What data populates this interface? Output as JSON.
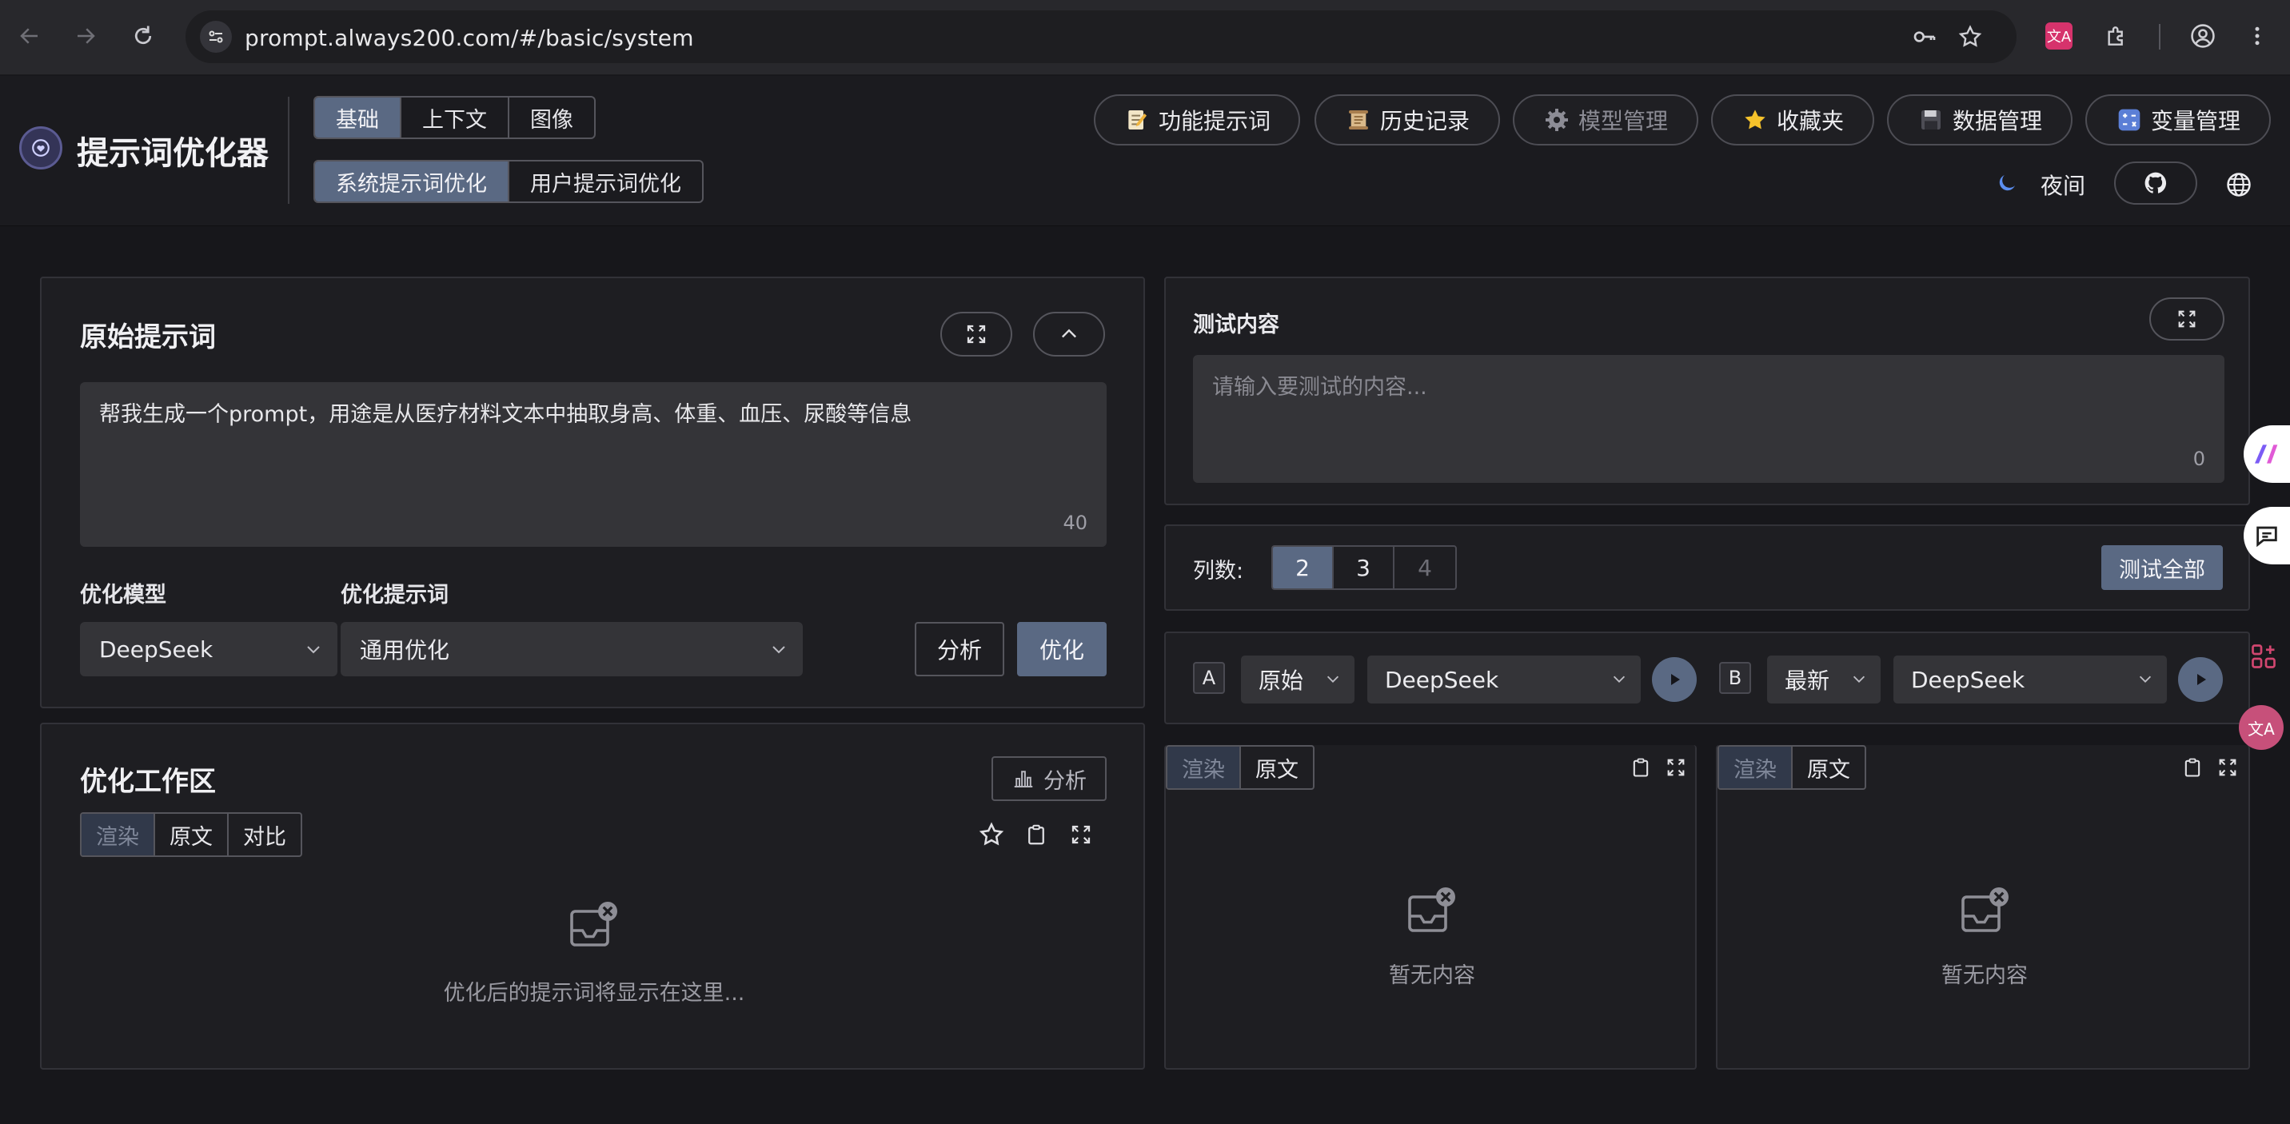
{
  "browser": {
    "url": "prompt.always200.com/#/basic/system"
  },
  "app": {
    "title": "提示词优化器",
    "mode_tabs": [
      {
        "label": "基础",
        "active": true
      },
      {
        "label": "上下文",
        "active": false
      },
      {
        "label": "图像",
        "active": false
      }
    ],
    "sub_tabs": [
      {
        "label": "系统提示词优化",
        "active": true
      },
      {
        "label": "用户提示词优化",
        "active": false
      }
    ],
    "nav_buttons": [
      {
        "label": "功能提示词",
        "icon": "memo-icon"
      },
      {
        "label": "历史记录",
        "icon": "scroll-icon"
      },
      {
        "label": "模型管理",
        "icon": "gear-icon"
      },
      {
        "label": "收藏夹",
        "icon": "star-icon"
      },
      {
        "label": "数据管理",
        "icon": "floppy-disk-icon"
      },
      {
        "label": "变量管理",
        "icon": "variables-icon"
      }
    ],
    "theme_label": "夜间"
  },
  "original_prompt": {
    "title": "原始提示词",
    "text": "帮我生成一个prompt，用途是从医疗材料文本中抽取身高、体重、血压、尿酸等信息",
    "char_count": "40",
    "model_label": "优化模型",
    "model_value": "DeepSeek",
    "template_label": "优化提示词",
    "template_value": "通用优化",
    "analyze_label": "分析",
    "optimize_label": "优化"
  },
  "workspace": {
    "title": "优化工作区",
    "analyze_label": "分析",
    "view_tabs": [
      {
        "label": "渲染",
        "active": true
      },
      {
        "label": "原文",
        "active": false
      },
      {
        "label": "对比",
        "active": false
      }
    ],
    "empty_text": "优化后的提示词将显示在这里..."
  },
  "test": {
    "title": "测试内容",
    "placeholder": "请输入要测试的内容...",
    "char_count": "0",
    "columns_label": "列数:",
    "columns": [
      {
        "label": "2",
        "active": true
      },
      {
        "label": "3",
        "active": false
      },
      {
        "label": "4",
        "active": false
      }
    ],
    "test_all_label": "测试全部",
    "slot_a": {
      "tag": "A",
      "version": "原始",
      "model": "DeepSeek"
    },
    "slot_b": {
      "tag": "B",
      "version": "最新",
      "model": "DeepSeek"
    },
    "result_tabs": [
      {
        "label": "渲染",
        "active": true
      },
      {
        "label": "原文",
        "active": false
      }
    ],
    "empty_text": "暂无内容"
  },
  "colors": {
    "accent": "#5a6983",
    "background": "#17171b",
    "panel": "#1e1e22",
    "input": "#343438"
  }
}
